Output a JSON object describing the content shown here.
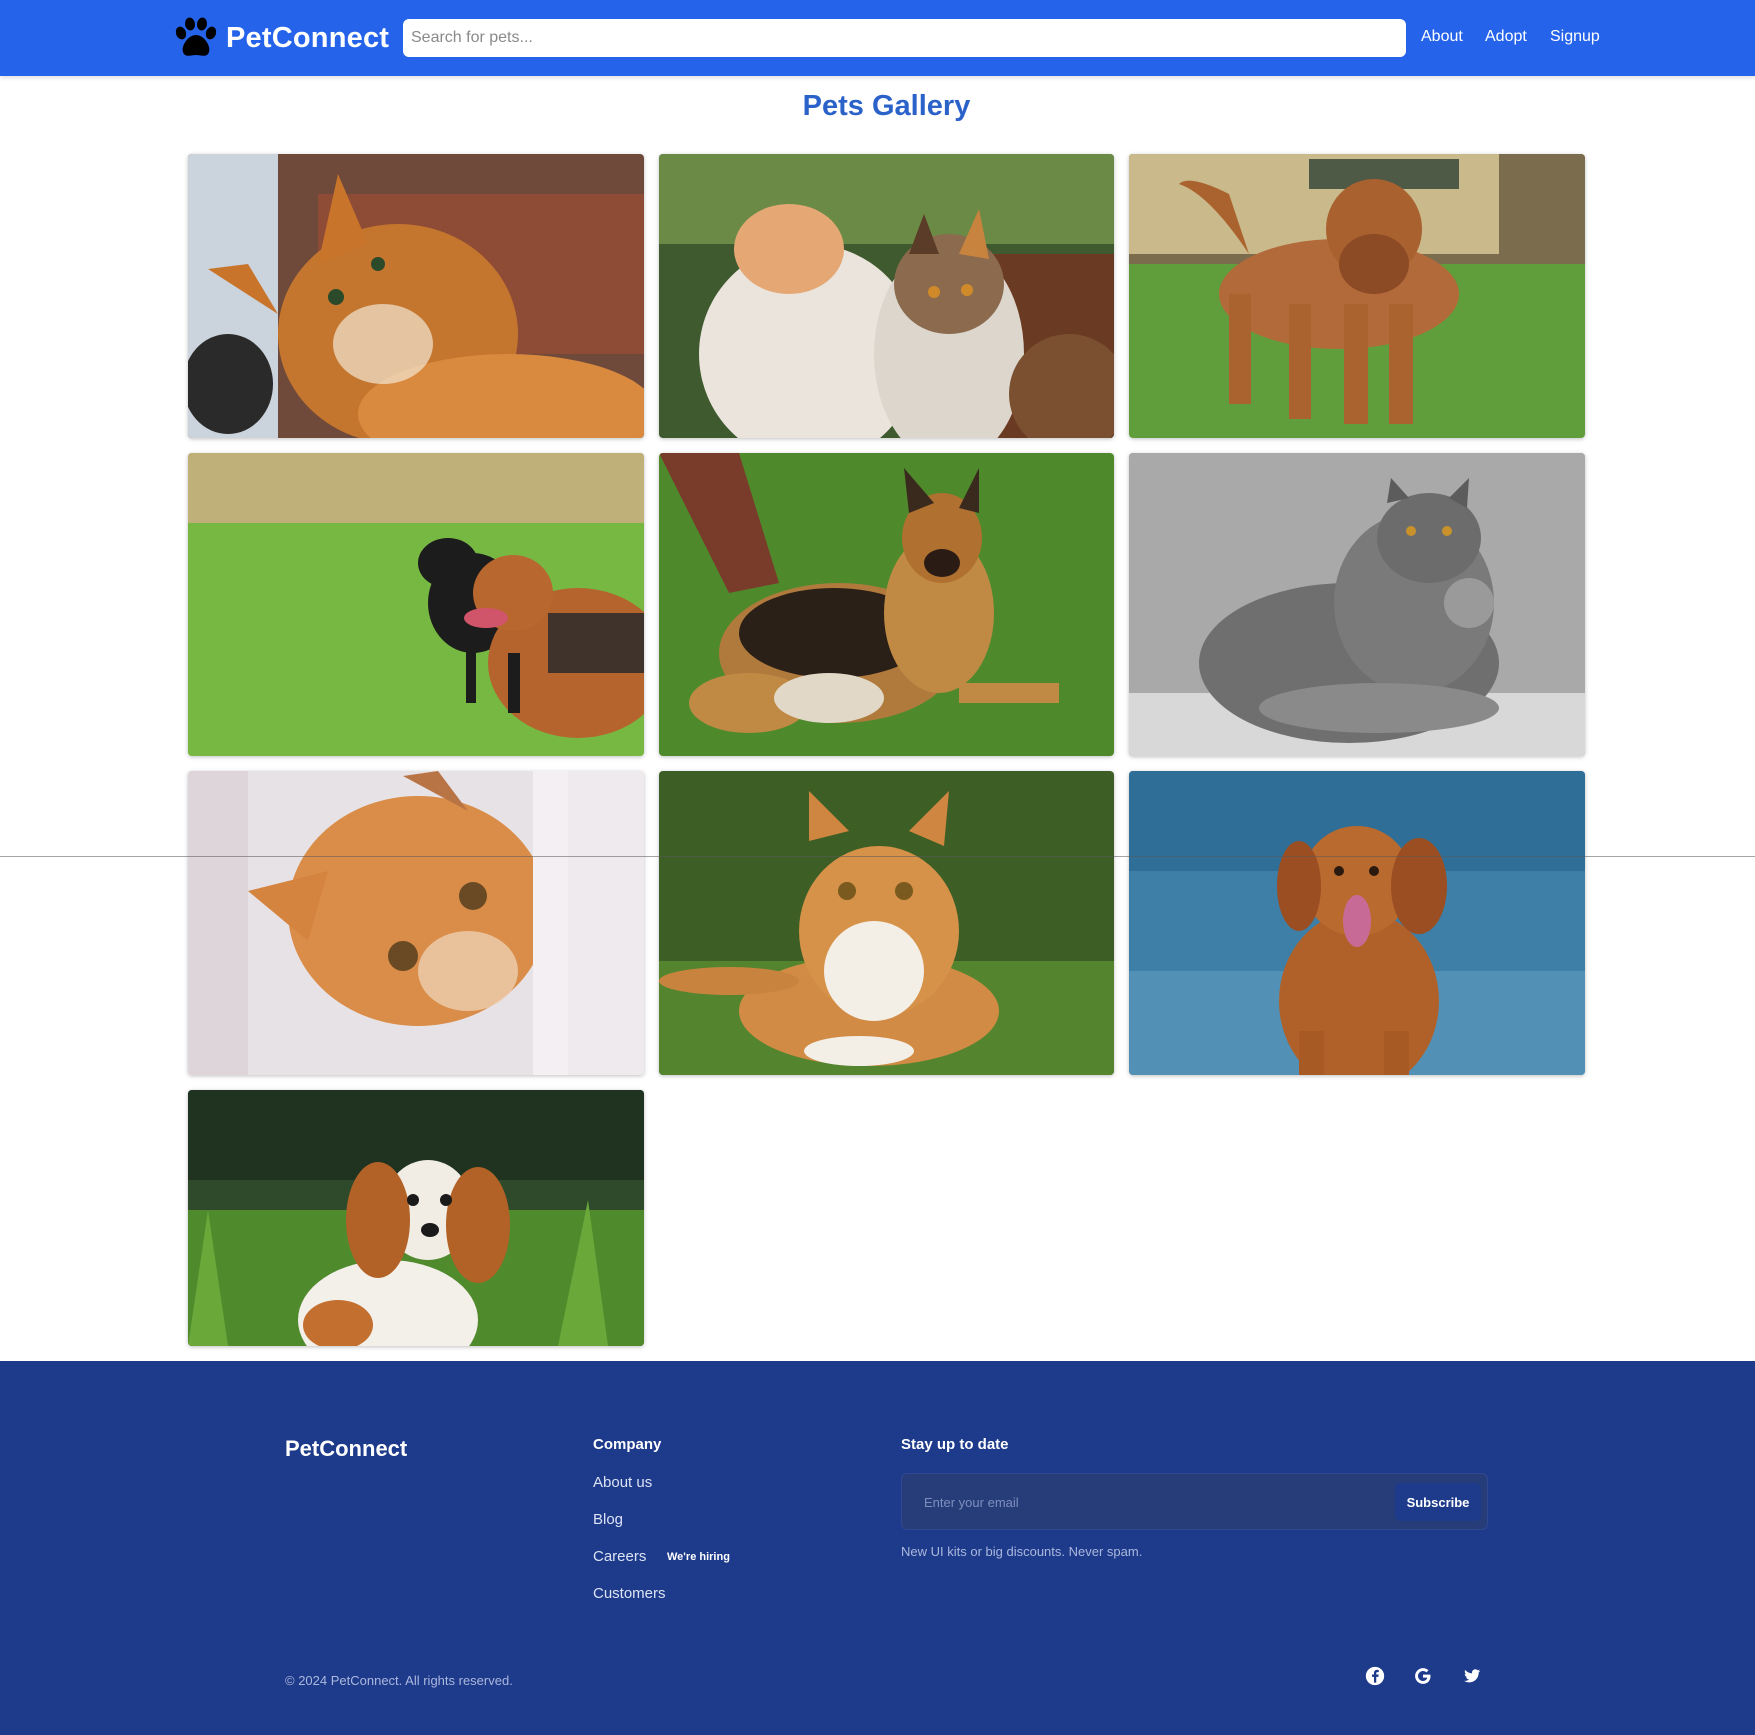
{
  "header": {
    "brand": "PetConnect",
    "search_placeholder": "Search for pets...",
    "nav": [
      {
        "label": "About"
      },
      {
        "label": "Adopt"
      },
      {
        "label": "Signup"
      }
    ],
    "bg_color": "#2563eb"
  },
  "main": {
    "title": "Pets Gallery",
    "title_color": "#2b62c9",
    "gallery": [
      {
        "subject": "orange tabby cat looking up",
        "icon": "pet-photo"
      },
      {
        "subject": "two cats in tall grass",
        "icon": "pet-photo"
      },
      {
        "subject": "brown mastiff dog on lawn",
        "icon": "pet-photo"
      },
      {
        "subject": "two dogs in grass field",
        "icon": "pet-photo"
      },
      {
        "subject": "german shepherd lying on grass",
        "icon": "pet-photo"
      },
      {
        "subject": "grey persian cat",
        "icon": "pet-photo"
      },
      {
        "subject": "orange cat peeking around corner",
        "icon": "pet-photo"
      },
      {
        "subject": "orange and white cat lying in grass",
        "icon": "pet-photo"
      },
      {
        "subject": "red retriever dog by water",
        "icon": "pet-photo"
      },
      {
        "subject": "cavalier spaniel in grass",
        "icon": "pet-photo"
      }
    ]
  },
  "footer": {
    "brand": "PetConnect",
    "company_heading": "Company",
    "company_links": [
      {
        "label": "About us"
      },
      {
        "label": "Blog"
      },
      {
        "label": "Careers",
        "badge": "We're hiring"
      },
      {
        "label": "Customers"
      }
    ],
    "newsletter_heading": "Stay up to date",
    "email_placeholder": "Enter your email",
    "subscribe_label": "Subscribe",
    "note": "New UI kits or big discounts. Never spam.",
    "copyright": "© 2024 PetConnect. All rights reserved.",
    "social": [
      "facebook-icon",
      "google-icon",
      "twitter-icon"
    ],
    "bg_color": "#1e3a8a"
  }
}
